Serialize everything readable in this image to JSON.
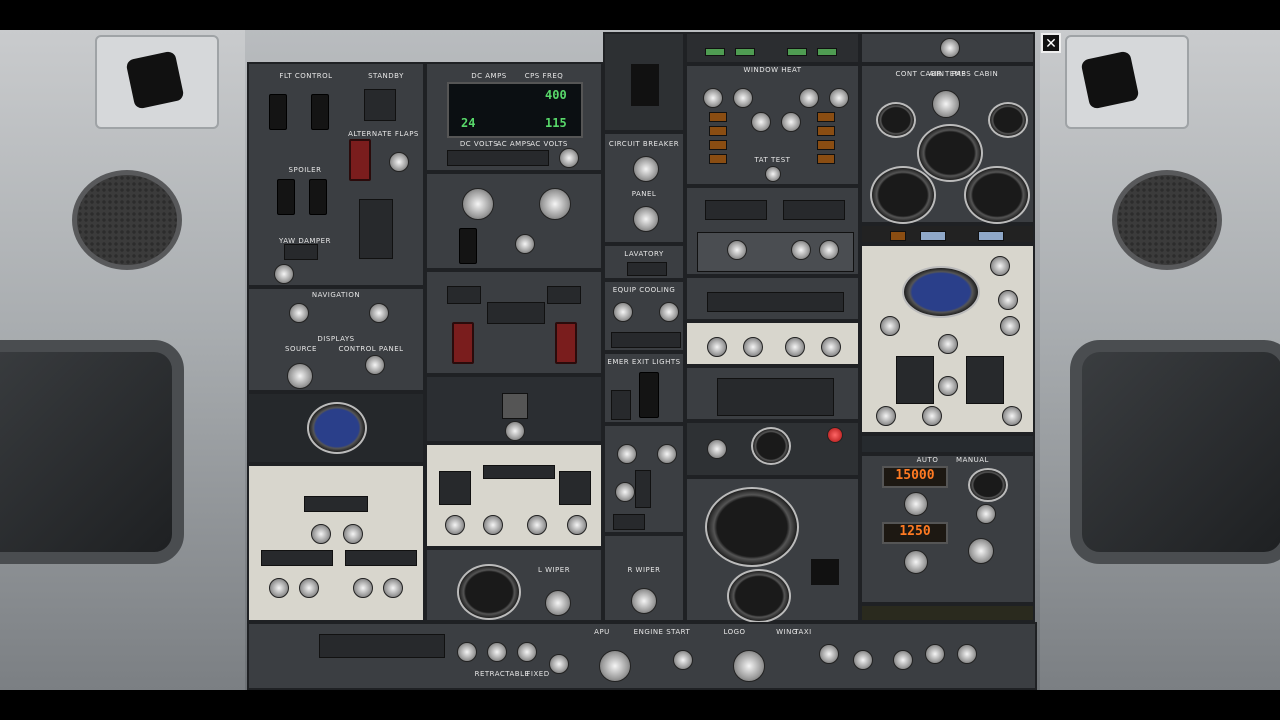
{
  "close_symbol": "✕",
  "overhead": {
    "flt_control": "FLT CONTROL",
    "standby": "STANDBY",
    "alternate_flaps": "ALTERNATE FLAPS",
    "spoiler": "SPOILER",
    "yaw_damper": "YAW DAMPER",
    "navigation": "NAVIGATION",
    "displays": "DISPLAYS",
    "source": "SOURCE",
    "control_panel": "CONTROL PANEL",
    "dc_amps": "DC AMPS",
    "cps_freq": "CPS FREQ",
    "dc_volts": "DC VOLTS",
    "ac_amps": "AC AMPS",
    "ac_volts": "AC VOLTS",
    "meter_val_1": "400",
    "meter_val_2": "24",
    "meter_val_3": "115",
    "circuit_breaker": "CIRCUIT BREAKER",
    "panel": "PANEL",
    "lavatory": "LAVATORY",
    "equip_cooling": "EQUIP COOLING",
    "emer_exit_lights": "EMER EXIT LIGHTS",
    "window_heat": "WINDOW HEAT",
    "tat_test": "TAT TEST",
    "cont_cabin": "CONT CABIN",
    "air_temp": "AIR TEMP",
    "pass_cabin": "PASS CABIN",
    "auto": "AUTO",
    "manual": "MANUAL",
    "alt_display_1": "15000",
    "alt_display_2": "1250",
    "engine_start": "ENGINE START",
    "apu": "APU",
    "l_wiper": "L WIPER",
    "r_wiper": "R WIPER",
    "retractable": "RETRACTABLE",
    "fixed": "FIXED",
    "logo": "LOGO",
    "wing": "WING",
    "taxi": "TAXI"
  },
  "colors": {
    "lcd_green": "#58d86a",
    "segment_orange": "#ff7a22",
    "panel_gray": "#3b3e42",
    "guard_red": "#7a1d1d"
  }
}
